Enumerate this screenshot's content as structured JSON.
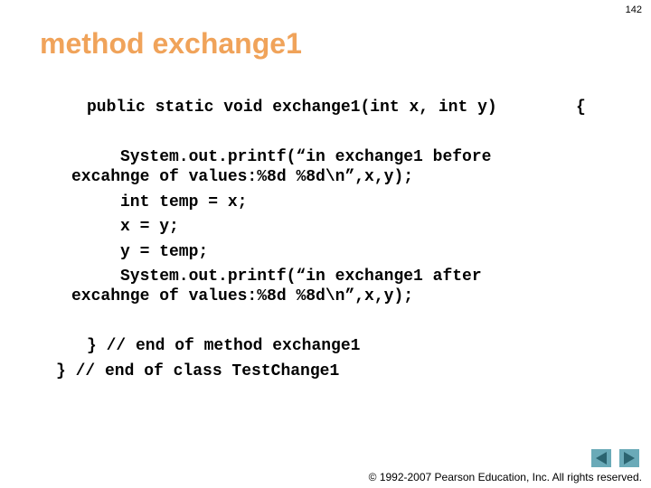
{
  "slide": {
    "page_number": "142",
    "title": "method exchange1"
  },
  "code": {
    "signature": "public static void exchange1(int x, int y)",
    "open_brace": "{",
    "line_printf_before_1": "System.out.printf(“in exchange1 before",
    "line_printf_before_2": "excahnge of values:%8d %8d\\n”,x,y);",
    "line_temp": "int temp = x;",
    "line_x": "x = y;",
    "line_y": "y = temp;",
    "line_printf_after_1": "System.out.printf(“in exchange1 after",
    "line_printf_after_2": "excahnge of values:%8d %8d\\n”,x,y);",
    "end_method": "} // end of method exchange1",
    "end_class": "} // end of class TestChange1"
  },
  "footer": {
    "prev_icon": "prev-slide-icon",
    "next_icon": "next-slide-icon",
    "copyright": "© 1992-2007 Pearson Education, Inc.  All rights reserved."
  }
}
